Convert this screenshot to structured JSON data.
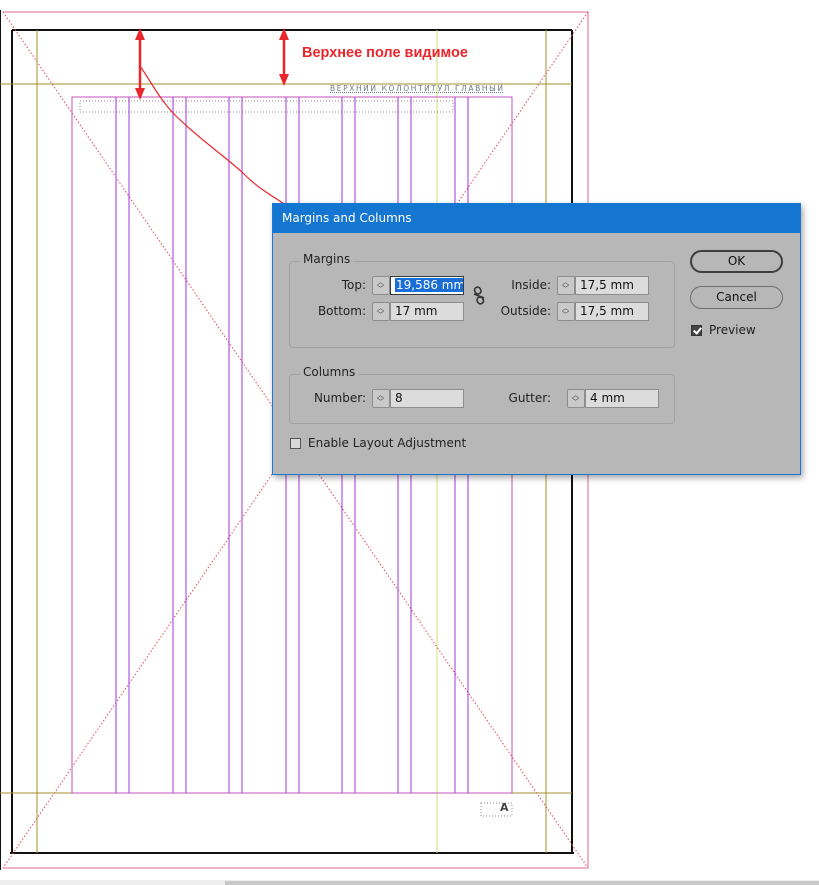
{
  "annotation": {
    "text": "Верхнее поле видимое",
    "color": "#e8262b"
  },
  "page": {
    "running_header": "ВЕРХНИЙ КОЛОНТИТУЛ ГЛАВНЫЙ",
    "page_number_marker": "A"
  },
  "dialog": {
    "title": "Margins and Columns",
    "margins": {
      "title": "Margins",
      "top_label": "Top:",
      "top_value": "19,586 mm",
      "bottom_label": "Bottom:",
      "bottom_value": "17 mm",
      "inside_label": "Inside:",
      "inside_value": "17,5 mm",
      "outside_label": "Outside:",
      "outside_value": "17,5 mm",
      "link_icon": "broken-chain-icon"
    },
    "columns": {
      "title": "Columns",
      "number_label": "Number:",
      "number_value": "8",
      "gutter_label": "Gutter:",
      "gutter_value": "4 mm"
    },
    "enable_layout_adjustment": {
      "label": "Enable Layout Adjustment",
      "checked": false
    },
    "buttons": {
      "ok": "OK",
      "cancel": "Cancel"
    },
    "preview": {
      "label": "Preview",
      "checked": true
    }
  },
  "colors": {
    "title_bar": "#1576d2",
    "dialog_bg": "#b7b7b7",
    "column_guides": "#a020f0",
    "margin_guides": "#d45aa8",
    "ruler_guides": "#b5a642",
    "bleed": "#e8262b"
  }
}
